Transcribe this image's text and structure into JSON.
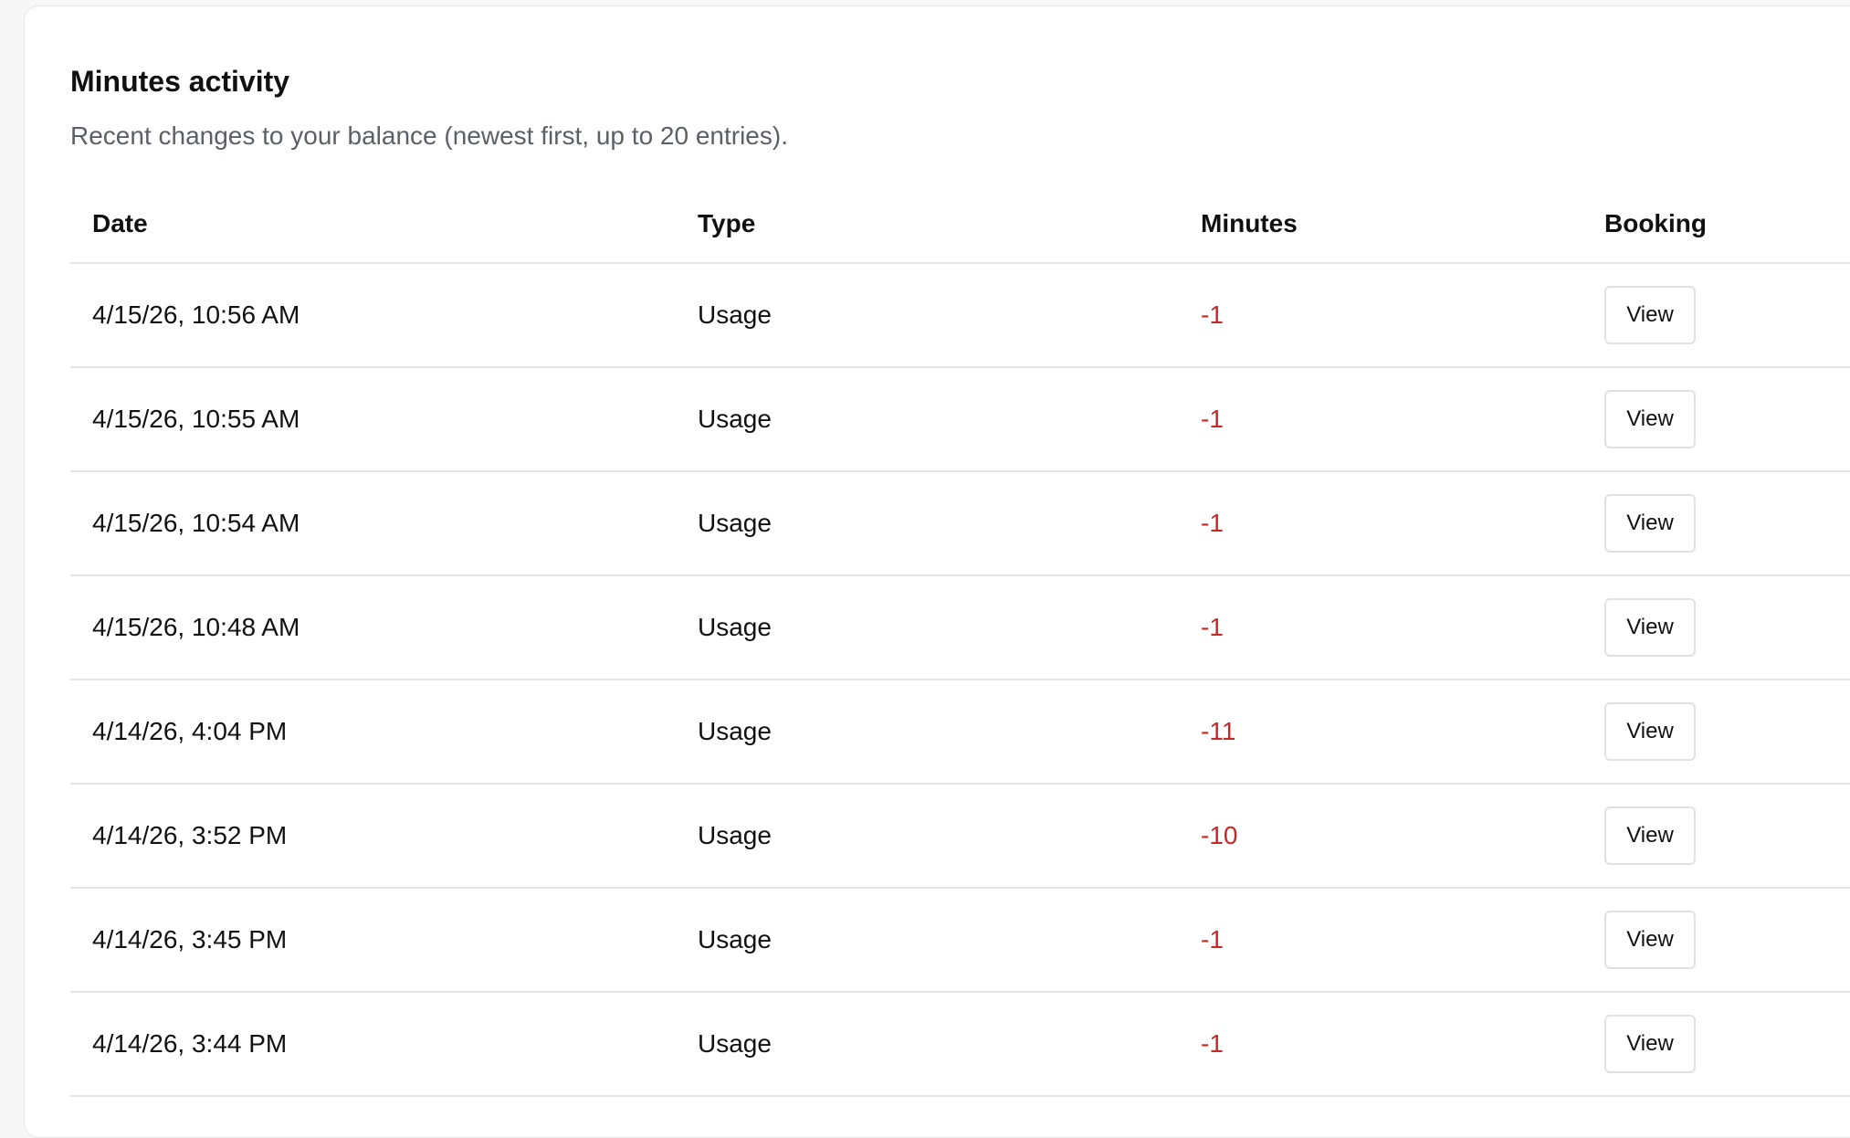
{
  "card": {
    "title": "Minutes activity",
    "subtitle": "Recent changes to your balance (newest first, up to 20 entries)."
  },
  "table": {
    "headers": {
      "date": "Date",
      "type": "Type",
      "minutes": "Minutes",
      "booking": "Booking"
    },
    "rows": [
      {
        "date": "4/15/26, 10:56 AM",
        "type": "Usage",
        "minutes": "-1",
        "booking_label": "View"
      },
      {
        "date": "4/15/26, 10:55 AM",
        "type": "Usage",
        "minutes": "-1",
        "booking_label": "View"
      },
      {
        "date": "4/15/26, 10:54 AM",
        "type": "Usage",
        "minutes": "-1",
        "booking_label": "View"
      },
      {
        "date": "4/15/26, 10:48 AM",
        "type": "Usage",
        "minutes": "-1",
        "booking_label": "View"
      },
      {
        "date": "4/14/26, 4:04 PM",
        "type": "Usage",
        "minutes": "-11",
        "booking_label": "View"
      },
      {
        "date": "4/14/26, 3:52 PM",
        "type": "Usage",
        "minutes": "-10",
        "booking_label": "View"
      },
      {
        "date": "4/14/26, 3:45 PM",
        "type": "Usage",
        "minutes": "-1",
        "booking_label": "View"
      },
      {
        "date": "4/14/26, 3:44 PM",
        "type": "Usage",
        "minutes": "-1",
        "booking_label": "View"
      }
    ]
  },
  "colors": {
    "negative_minutes": "#c62828",
    "border": "#e4e4e7",
    "subtitle": "#5b5f66"
  }
}
